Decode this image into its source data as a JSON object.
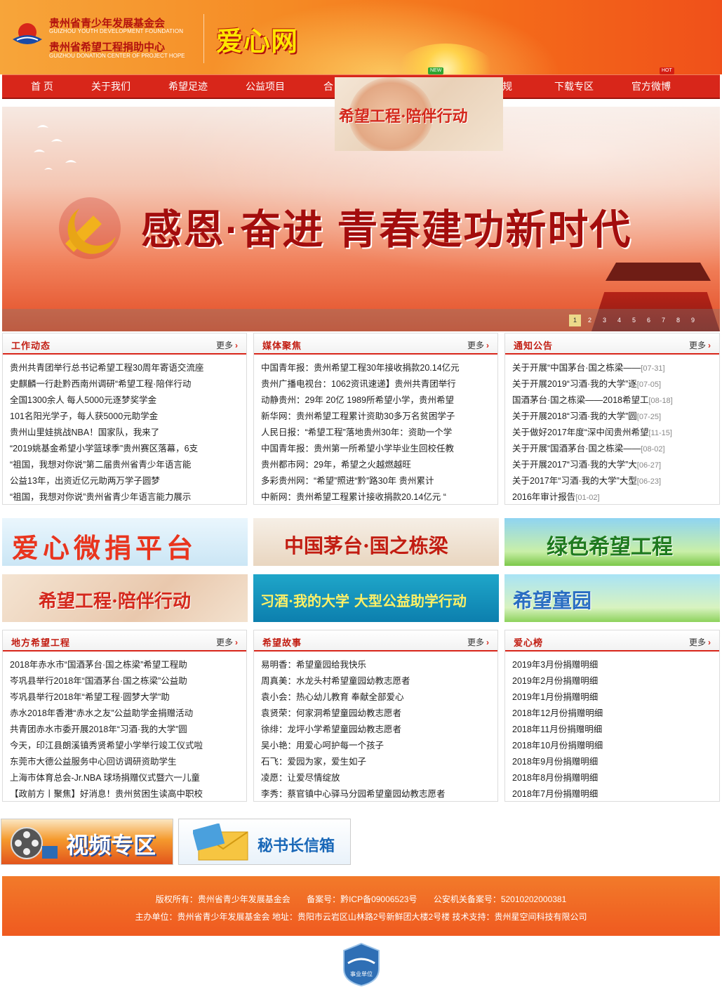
{
  "header": {
    "org_cn_1": "贵州省青少年发展基金会",
    "org_en_1": "GUIZHOU YOUTH DEVELOPMENT FOUNDATION",
    "org_cn_2": "贵州省希望工程捐助中心",
    "org_en_2": "GUIZHOU DONATION CENTER OF PROJECT HOPE",
    "brand": "爱心网"
  },
  "nav": {
    "items": [
      "首 页",
      "关于我们",
      "希望足迹",
      "公益项目",
      "合",
      "规",
      "下载专区",
      "官方微博"
    ],
    "badge_new": "NEW",
    "badge_hot": "HOT"
  },
  "float_ad": {
    "text": "希望工程·陪伴行动"
  },
  "banner": {
    "title": "感恩·奋进  青春建功新时代",
    "pages": [
      "1",
      "2",
      "3",
      "4",
      "5",
      "6",
      "7",
      "8",
      "9"
    ],
    "active_page": "1"
  },
  "panels": {
    "work": {
      "title": "工作动态",
      "more": "更多",
      "items": [
        "贵州共青团举行总书记希望工程30周年寄语交流座",
        "史麒麟一行赴黔西南州调研“希望工程·陪伴行动",
        "全国1300余人  每人5000元逐梦奖学金",
        "101名阳光学子，每人获5000元助学金",
        "贵州山里娃挑战NBA！国家队，我来了",
        "“2019姚基金希望小学篮球季”贵州赛区落幕，6支",
        "“祖国，我想对你说”第二届贵州省青少年语言能",
        "公益13年，出资近亿元助两万学子圆梦",
        "“祖国，我想对你说”贵州省青少年语言能力展示"
      ]
    },
    "media": {
      "title": "媒体聚焦",
      "more": "更多",
      "items": [
        "中国青年报：贵州希望工程30年接收捐款20.14亿元",
        "贵州广播电视台：1062资讯速递】贵州共青团举行",
        "动静贵州：29年 20亿 1989所希望小学，贵州希望",
        "新华网：贵州希望工程累计资助30多万名贫困学子",
        "人民日报：“希望工程”落地贵州30年：资助一个学",
        "中国青年报：贵州第一所希望小学毕业生回校任教",
        "贵州都市网：29年，希望之火越燃越旺",
        "多彩贵州网：“希望”照进“黔”路30年 贵州累计",
        "中新网：贵州希望工程累计接收捐款20.14亿元 “"
      ]
    },
    "notice": {
      "title": "通知公告",
      "more": "更多",
      "items": [
        {
          "text": "关于开展“中国茅台·国之栋梁——",
          "date": "[07-31]"
        },
        {
          "text": "关于开展2019“习酒·我的大学”逐",
          "date": "[07-05]"
        },
        {
          "text": "国酒茅台·国之栋梁——2018希望工",
          "date": "[08-18]"
        },
        {
          "text": "关于开展2018“习酒·我的大学”圆",
          "date": "[07-25]"
        },
        {
          "text": "关于做好2017年度“深中闰贵州希望",
          "date": "[11-15]"
        },
        {
          "text": "关于开展“国酒茅台·国之栋梁——",
          "date": "[08-02]"
        },
        {
          "text": "关于开展2017“习酒·我的大学”大",
          "date": "[06-27]"
        },
        {
          "text": "关于2017年“习酒·我的大学”大型",
          "date": "[06-23]"
        },
        {
          "text": "2016年审计报告",
          "date": "[01-02]"
        }
      ]
    },
    "local": {
      "title": "地方希望工程",
      "more": "更多",
      "items": [
        "2018年赤水市“国酒茅台·国之栋梁”希望工程助",
        "岑巩县举行2018年“国酒茅台·国之栋梁”公益助",
        "岑巩县举行2018年“希望工程·圆梦大学”助",
        "赤水2018年香港“赤水之友”公益助学金捐赠活动",
        "共青团赤水市委开展2018年“习酒·我的大学”圆",
        "今天，印江县朗溪镇秀贤希望小学举行竣工仪式啦",
        "东莞市大德公益服务中心回访调研资助学生",
        "上海市体育总会-Jr.NBA 球场捐赠仪式暨六一儿童",
        "【政前方丨聚焦】好消息！贵州贫困生读高中职校"
      ]
    },
    "story": {
      "title": "希望故事",
      "more": "更多",
      "items": [
        "易明香：希望童园给我快乐",
        "周真美：水龙头村希望童园幼教志愿者",
        "袁小会：热心幼儿教育  奉献全部爱心",
        "袁贤荣：何家洞希望童园幼教志愿者",
        "徐绯：龙坪小学希望童园幼教志愿者",
        "吴小艳：用爱心呵护每一个孩子",
        "石飞：爱园为家，爱生如子",
        "凌愿：让爱尽情绽放",
        "李秀：蔡官镇中心驿马分园希望童园幼教志愿者"
      ]
    },
    "love": {
      "title": "爱心榜",
      "more": "更多",
      "items": [
        "2019年3月份捐赠明细",
        "2019年2月份捐赠明细",
        "2019年1月份捐赠明细",
        "2018年12月份捐赠明细",
        "2018年11月份捐赠明细",
        "2018年10月份捐赠明细",
        "2018年9月份捐赠明细",
        "2018年8月份捐赠明细",
        "2018年7月份捐赠明细"
      ]
    }
  },
  "ads": {
    "a1": "爱心微捐平台",
    "a2": "中国茅台·国之栋梁",
    "a3": "绿色希望工程",
    "a4": "希望工程·陪伴行动",
    "a5": "习酒·我的大学 大型公益助学行动",
    "a6": "希望童园",
    "video": "视频专区",
    "secretary": "秘书长信箱"
  },
  "footer": {
    "copyright": "版权所有：贵州省青少年发展基金会",
    "icp": "备案号：黔ICP备09006523号",
    "police": "公安机关备案号：52010202000381",
    "line2": "主办单位：贵州省青少年发展基金会 地址：贵阳市云岩区山林路2号新鲜团大楼2号楼 技术支持：贵州星空间科技有限公司",
    "seal_text": "事业单位"
  },
  "colors": {
    "accent": "#d8261a",
    "footer": "#ef5a20",
    "title": "#c21d12"
  }
}
